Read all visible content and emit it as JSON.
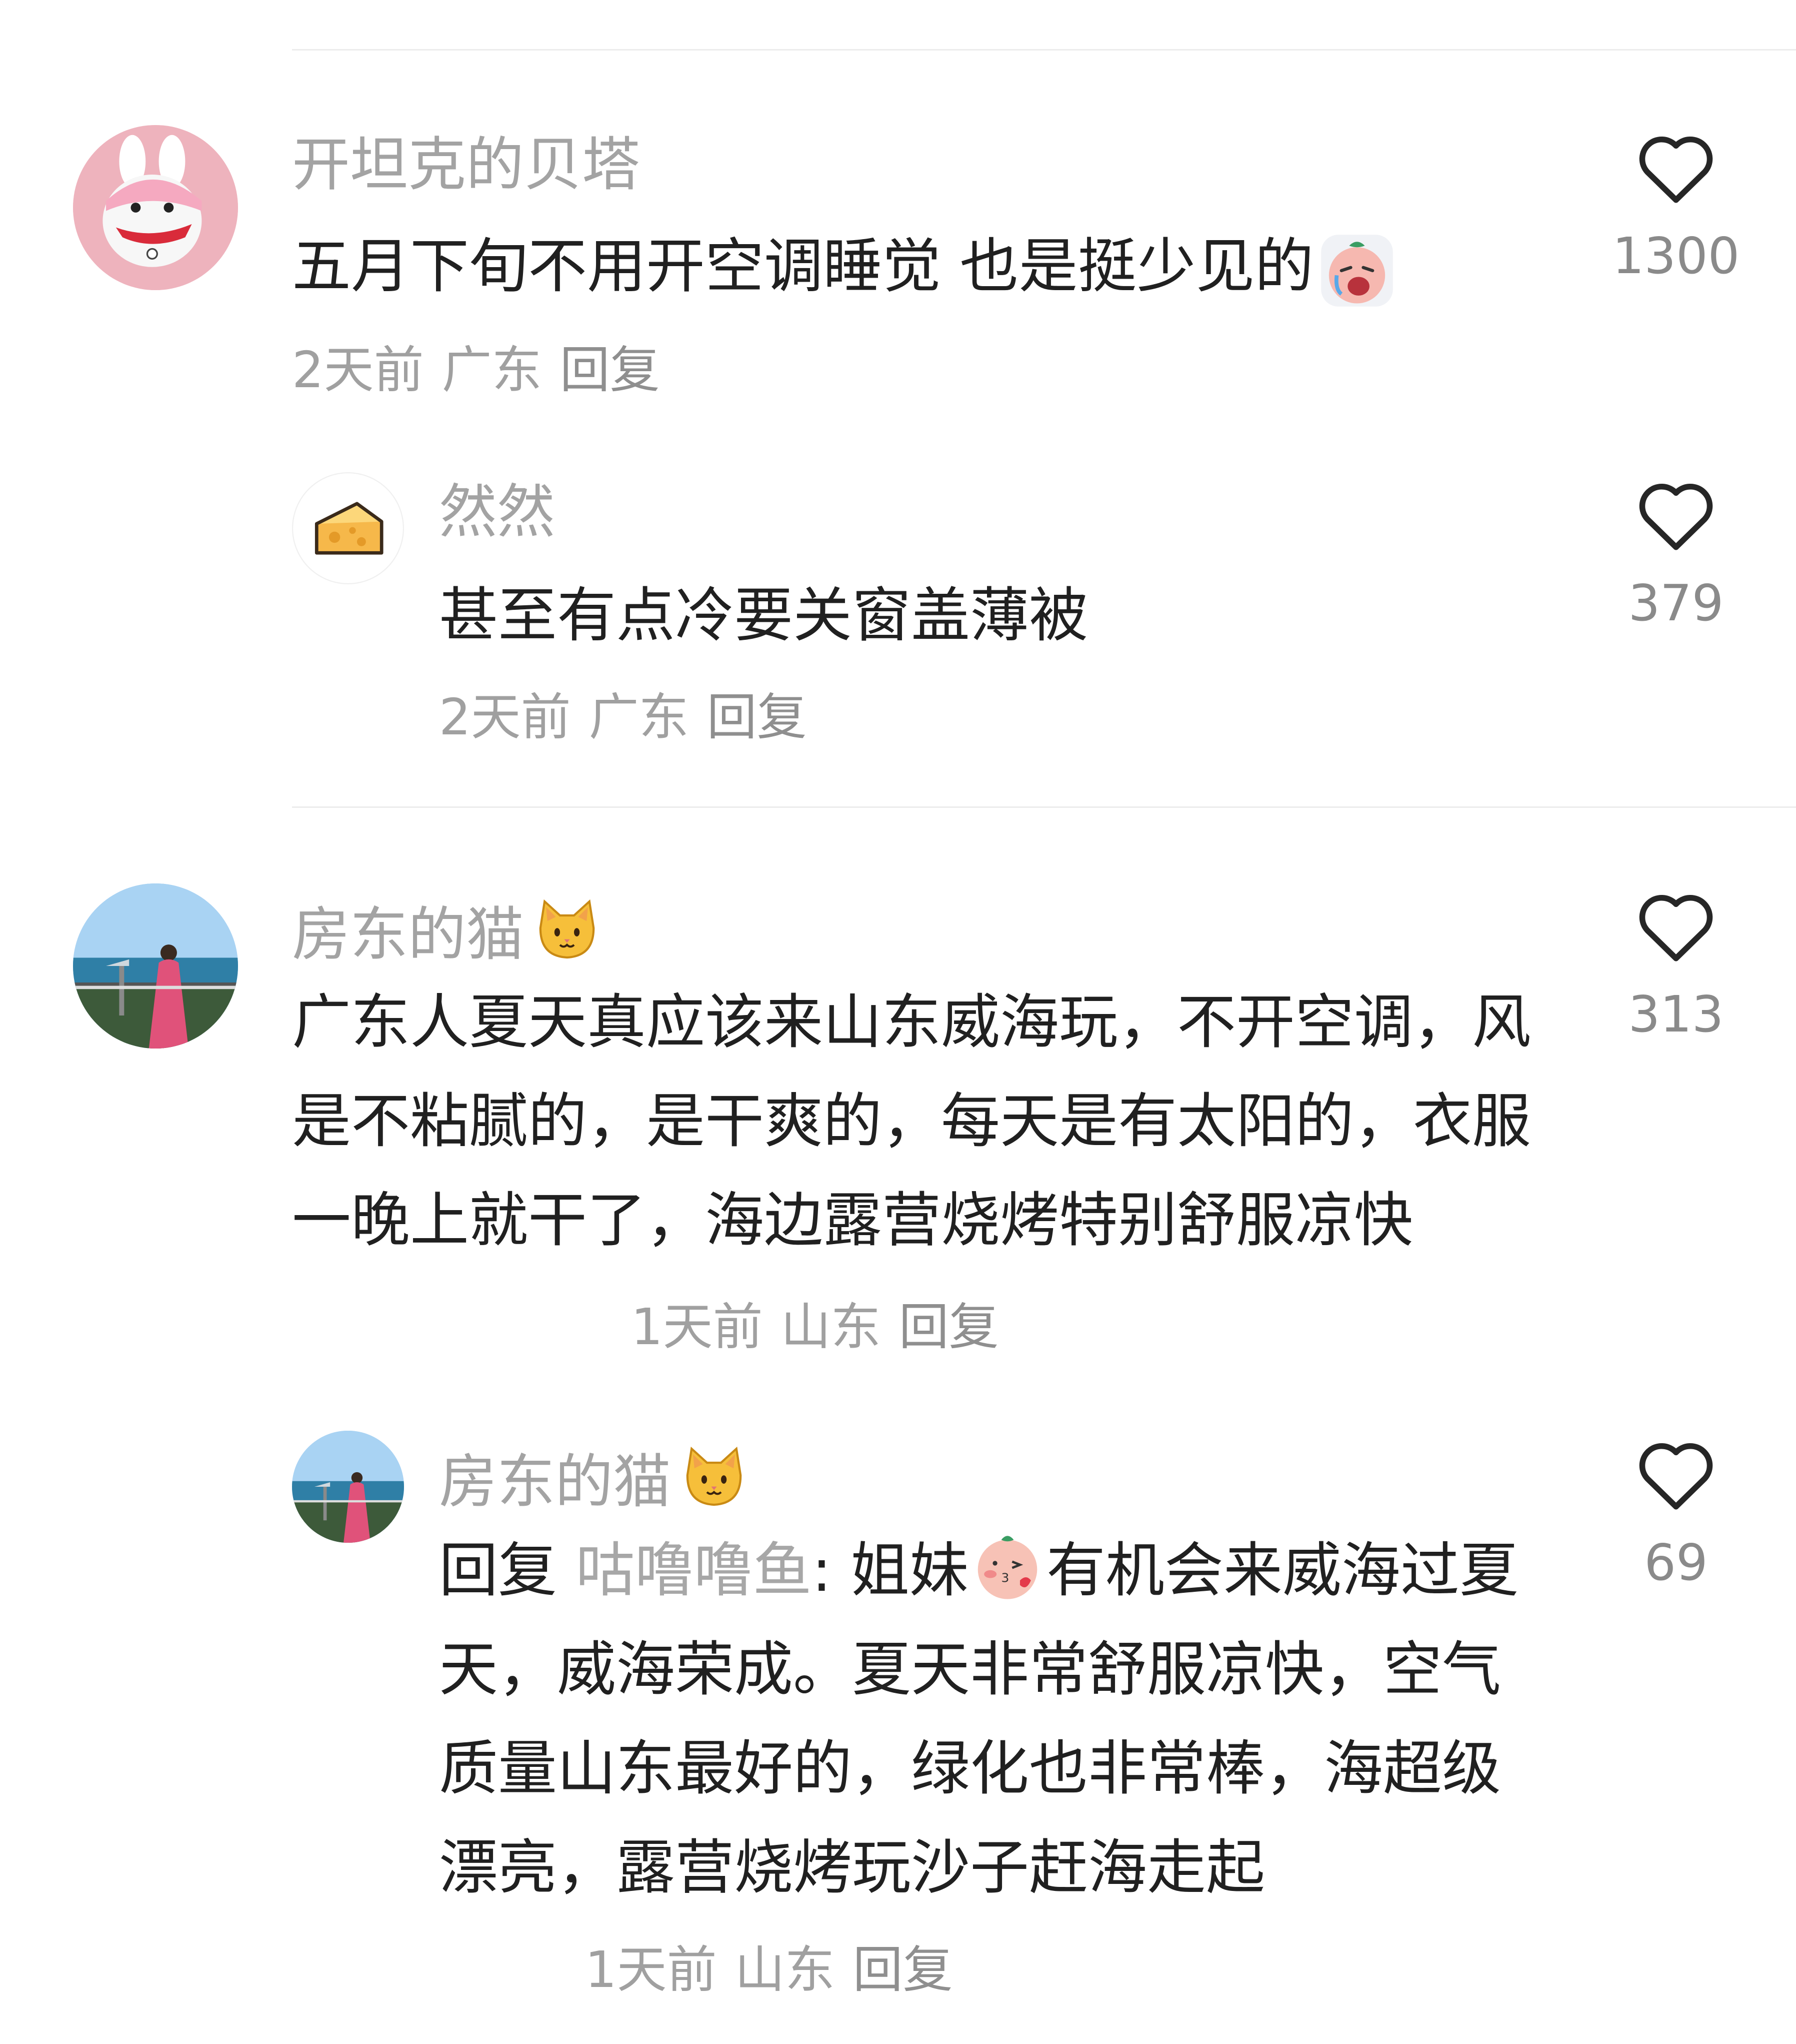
{
  "comments": [
    {
      "username": "开坦克的贝塔",
      "text": "五月下旬不用开空调睡觉 也是挺少见的",
      "emoji": "crying-face-emoji",
      "time": "2天前",
      "location": "广东",
      "reply_label": "回复",
      "likes": "1300",
      "replies": [
        {
          "username": "然然",
          "text": "甚至有点冷要关窗盖薄被",
          "time": "2天前",
          "location": "广东",
          "reply_label": "回复",
          "likes": "379"
        }
      ]
    },
    {
      "username": "房东的猫",
      "username_emoji": "cat-face-emoji",
      "text": "广东人夏天真应该来山东威海玩，不开空调，风是不粘腻的，是干爽的，每天是有太阳的，衣服一晚上就干了，海边露营烧烤特别舒服凉快",
      "time": "1天前",
      "location": "山东",
      "reply_label": "回复",
      "likes": "313",
      "replies": [
        {
          "username": "房东的猫",
          "username_emoji": "cat-face-emoji",
          "reply_prefix": "回复",
          "mention": "咕噜噜鱼",
          "mention_colon": ":",
          "text_before_emoji": "姐妹",
          "emoji": "kissing-face-emoji",
          "text": "有机会来威海过夏天，威海荣成。夏天非常舒服凉快，空气质量山东最好的，绿化也非常棒，海超级漂亮，露营烧烤玩沙子赶海走起",
          "time": "1天前",
          "location": "山东",
          "reply_label": "回复",
          "likes": "69"
        }
      ]
    }
  ],
  "colors": {
    "text": "#202020",
    "muted": "#a0a0a0",
    "divider": "#ececec",
    "heart_stroke": "#262626"
  }
}
